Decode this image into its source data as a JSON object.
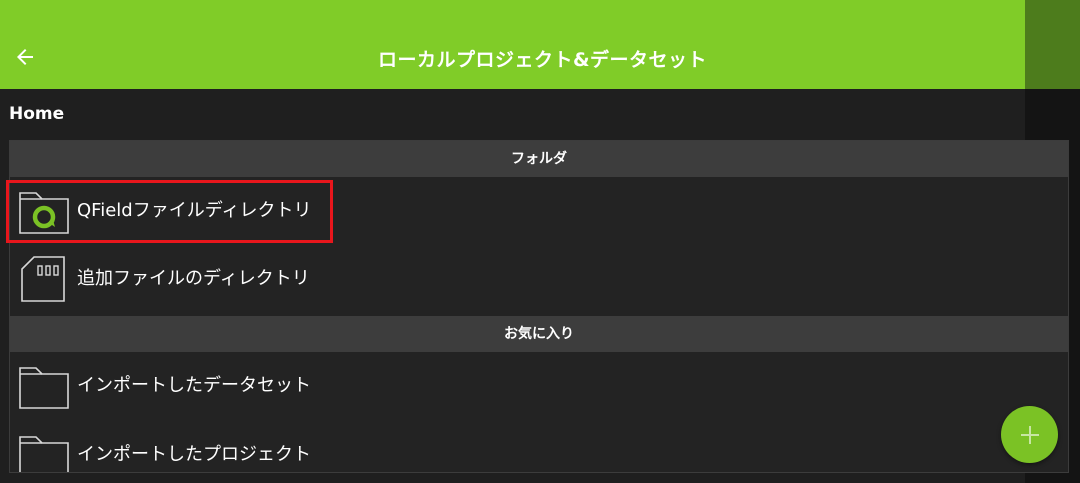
{
  "header": {
    "title": "ローカルプロジェクト&データセット",
    "back_icon": "arrow-left-icon"
  },
  "breadcrumb": "Home",
  "sections": [
    {
      "title": "フォルダ",
      "items": [
        {
          "label": "QFieldファイルディレクトリ",
          "icon": "qfield-folder-icon"
        },
        {
          "label": "追加ファイルのディレクトリ",
          "icon": "sd-card-icon"
        }
      ]
    },
    {
      "title": "お気に入り",
      "items": [
        {
          "label": "インポートしたデータセット",
          "icon": "folder-icon"
        },
        {
          "label": "インポートしたプロジェクト",
          "icon": "folder-icon"
        }
      ]
    }
  ],
  "fab": {
    "icon": "plus-icon"
  },
  "colors": {
    "accent": "#80cc28",
    "accent_dark": "#4d7c1c",
    "background": "#1f1f1f",
    "section_header": "#3d3d3d",
    "highlight": "#e8161c",
    "fab": "#7bc225"
  }
}
